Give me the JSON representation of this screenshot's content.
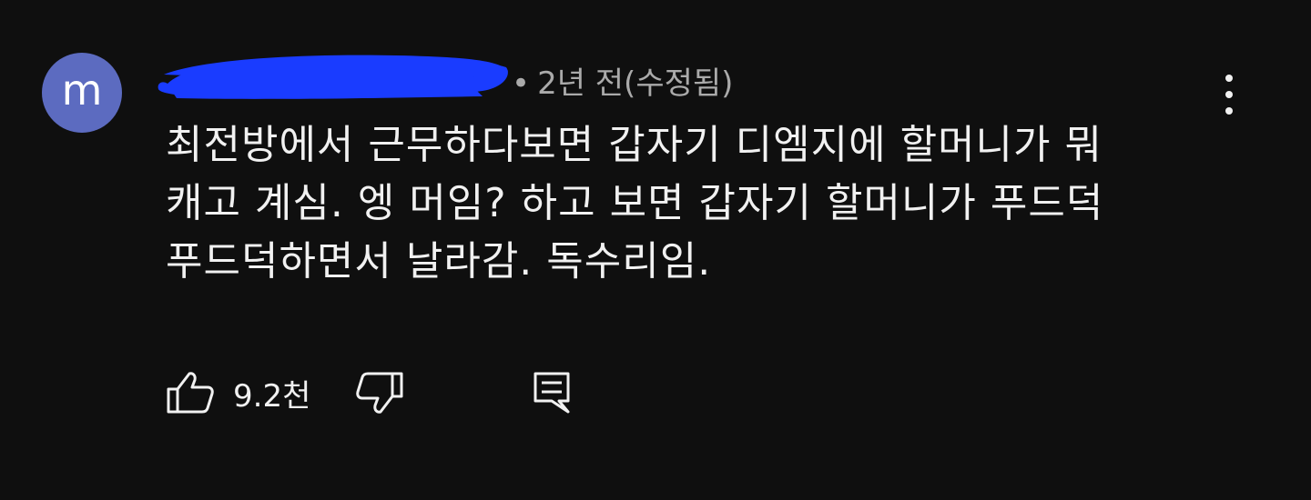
{
  "comment": {
    "avatar_letter": "m",
    "author": "",
    "timestamp": "2년 전(수정됨)",
    "separator": "•",
    "text_lines": [
      "최전방에서 근무하다보면 갑자기 디엠지에 할머니가 뭐",
      "캐고 계심. 엥 머임? 하고 보면 갑자기 할머니가 푸드덕",
      "푸드덕하면서 날라감. 독수리임."
    ],
    "like_count": "9.2천"
  },
  "colors": {
    "background": "#0f0f0f",
    "avatar": "#5c6bc0",
    "redaction": "#1a3cff",
    "secondary_text": "#aaaaaa",
    "primary_text": "#f1f1f1"
  },
  "icons": {
    "like": "thumbs-up-icon",
    "dislike": "thumbs-down-icon",
    "reply": "reply-comment-icon",
    "menu": "more-vert-icon"
  }
}
